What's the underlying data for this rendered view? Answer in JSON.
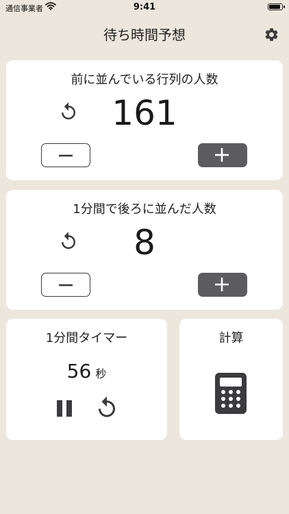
{
  "status_bar": {
    "carrier": "通信事業者",
    "time": "9:41"
  },
  "header": {
    "title": "待ち時間予想",
    "settings_icon": "gear-icon"
  },
  "queue_card": {
    "title": "前に並んでいる行列の人数",
    "value": "161",
    "reset_icon": "reset-icon",
    "minus_icon": "minus-icon",
    "plus_icon": "plus-icon"
  },
  "rate_card": {
    "title": "1分間で後ろに並んだ人数",
    "value": "8",
    "reset_icon": "reset-icon",
    "minus_icon": "minus-icon",
    "plus_icon": "plus-icon"
  },
  "timer_card": {
    "title": "1分間タイマー",
    "value": "56",
    "unit": "秒",
    "pause_icon": "pause-icon",
    "reset_icon": "reset-icon"
  },
  "calc_card": {
    "title": "計算",
    "icon": "calculator-icon"
  },
  "colors": {
    "background": "#ece6dc",
    "card": "#ffffff",
    "plus_button": "#5b5b60",
    "icon": "#3b3b3d"
  }
}
